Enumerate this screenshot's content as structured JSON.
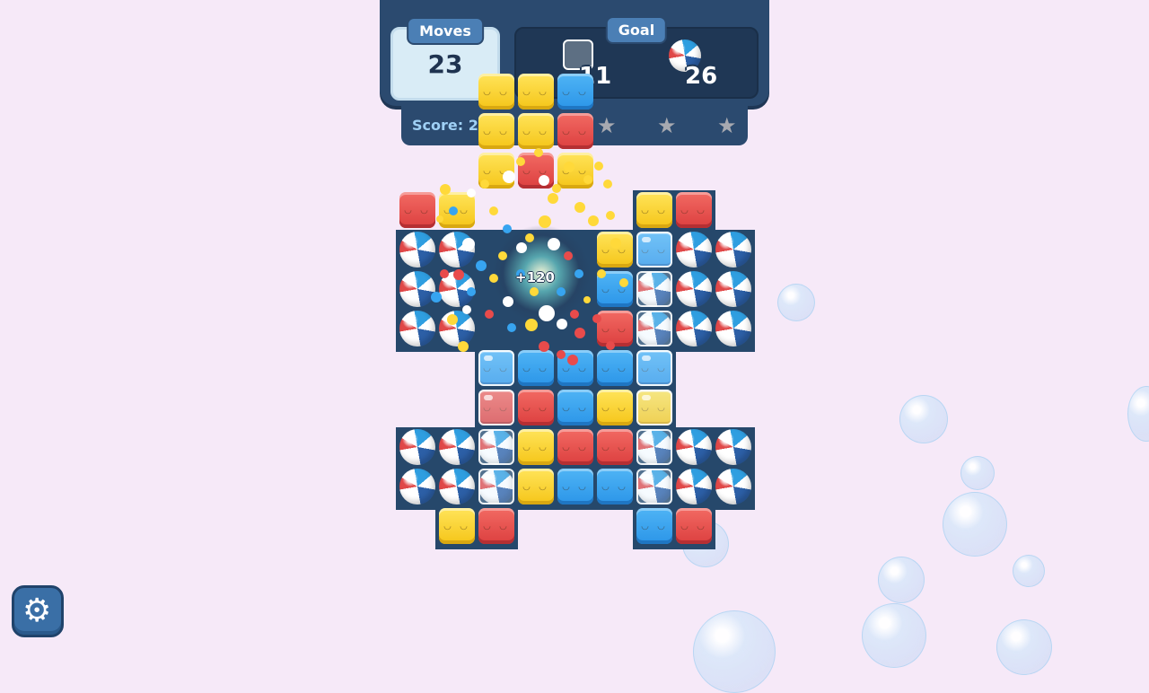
{
  "hud": {
    "moves_label": "Moves",
    "moves_value": "23",
    "goal_label": "Goal",
    "goals": [
      {
        "icon": "ice-block-icon",
        "count": "11"
      },
      {
        "icon": "beach-ball-icon",
        "count": "26"
      }
    ],
    "score_label": "Score: 2",
    "stars_total": 3,
    "stars_earned": 0
  },
  "effects": {
    "score_popup": "+120"
  },
  "settings": {
    "icon": "gear-icon"
  },
  "colors": {
    "background": "#f6e9f8",
    "hud": "#2b4a6f",
    "yellow_tile": "#f5c518",
    "red_tile": "#dc3f3f",
    "blue_tile": "#2b95e8"
  }
}
